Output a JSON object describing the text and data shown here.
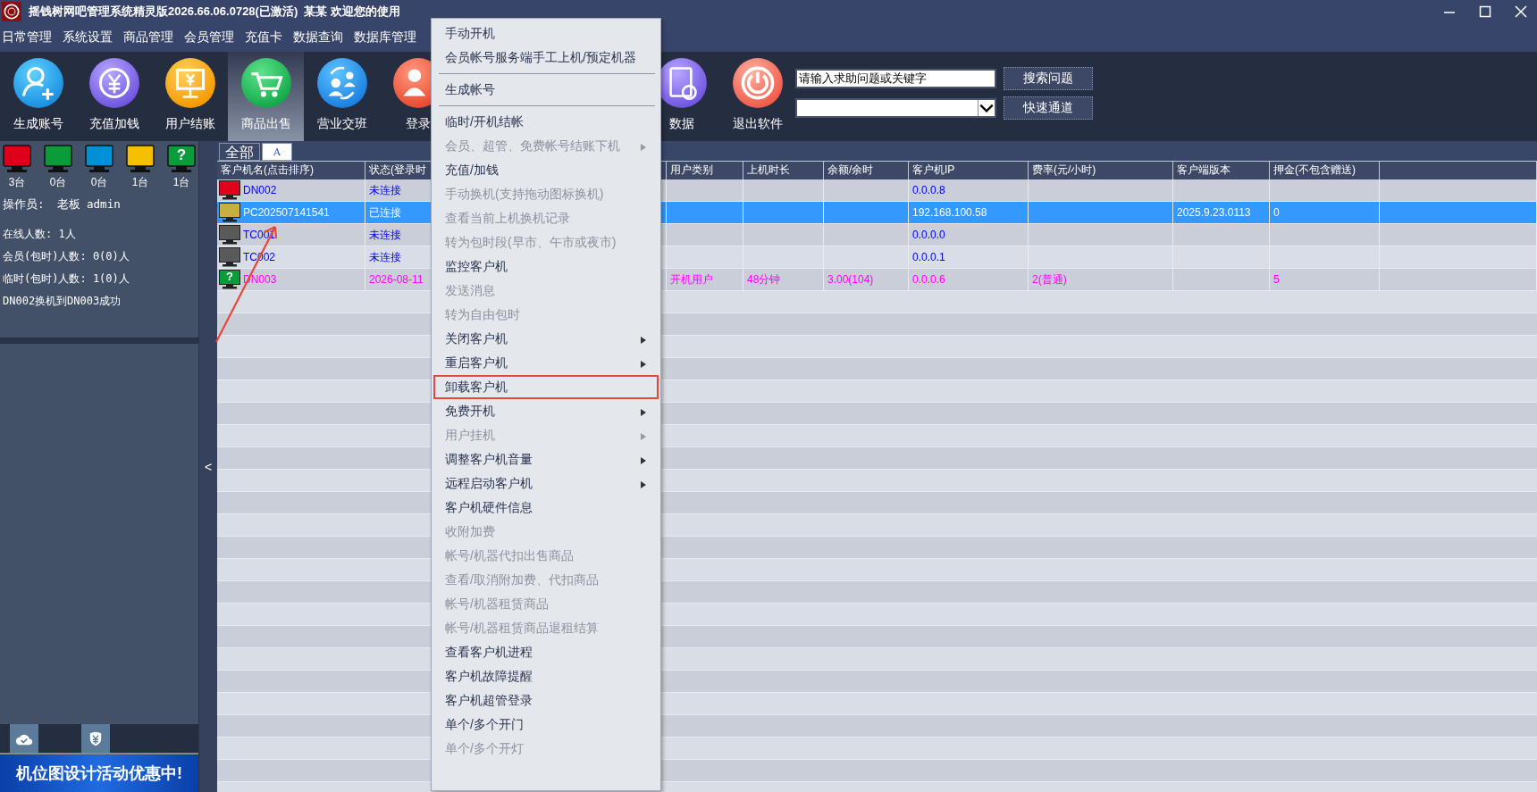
{
  "window": {
    "title": "摇钱树网吧管理系统精灵版2026.66.06.0728(已激活)  某某 欢迎您的使用"
  },
  "menu_bar": [
    "日常管理",
    "系统设置",
    "商品管理",
    "会员管理",
    "充值卡",
    "数据查询",
    "数据库管理"
  ],
  "toolbar": [
    {
      "label": "生成账号",
      "kind": "add-user",
      "selected": false
    },
    {
      "label": "充值加钱",
      "kind": "recharge",
      "selected": false
    },
    {
      "label": "用户结账",
      "kind": "checkout",
      "selected": false
    },
    {
      "label": "商品出售",
      "kind": "sale",
      "selected": true
    },
    {
      "label": "营业交班",
      "kind": "shift",
      "selected": false
    },
    {
      "label": "登录",
      "kind": "login",
      "selected": false
    },
    {
      "label": "数据",
      "kind": "data",
      "selected": false
    },
    {
      "label": "退出软件",
      "kind": "exit",
      "selected": false
    }
  ],
  "search": {
    "value": "请输入求助问题或关键字",
    "button": "搜索问题"
  },
  "quick_access": {
    "button": "快速通道"
  },
  "status_summary": [
    {
      "color": "#e0001b",
      "count": "3台"
    },
    {
      "color": "#0a9c3a",
      "count": "0台"
    },
    {
      "color": "#0090d8",
      "count": "0台"
    },
    {
      "color": "#f5c000",
      "count": "1台"
    },
    {
      "color": "#0a9c3a",
      "count": "1台",
      "badge": "?"
    }
  ],
  "operator": {
    "label": "操作员:",
    "name": "老板 admin"
  },
  "stats": [
    "在线人数: 1人",
    "会员(包时)人数: 0(0)人",
    "临时(包时)人数: 1(0)人"
  ],
  "message": "DN002换机到DN003成功",
  "collapse_button": "<",
  "banner": "机位图设计活动优惠中!",
  "tabs": [
    {
      "label": "全部",
      "selected": true
    },
    {
      "label": "A",
      "selected": false
    }
  ],
  "table": {
    "columns": [
      "客户机名(点击排序)",
      "状态(登录时",
      "用户类别",
      "上机时长",
      "余额/余时",
      "客户机IP",
      "费率(元/小时)",
      "客户端版本",
      "押金(不包含赠送)"
    ],
    "rows": [
      {
        "kind": "offline",
        "selected": false,
        "color": "#e0001b",
        "name": "DN002",
        "status": "未连接",
        "ip": "0.0.0.8"
      },
      {
        "kind": "online",
        "selected": true,
        "color": "#c8b040",
        "name": "PC202507141541",
        "status": "已连接",
        "ip": "192.168.100.58",
        "version": "2025.9.23.0113",
        "deposit": "0"
      },
      {
        "kind": "offline",
        "selected": false,
        "color": "#5a5a5a",
        "name": "TC001",
        "status": "未连接",
        "ip": "0.0.0.0"
      },
      {
        "kind": "offline",
        "selected": false,
        "color": "#5a5a5a",
        "name": "TC002",
        "status": "未连接",
        "ip": "0.0.0.1"
      },
      {
        "kind": "timed",
        "selected": false,
        "color": "#0a9c3a",
        "badge": "?",
        "name": "DN003",
        "status": "2026-08-11",
        "user_type": "开机用户",
        "online_time": "48分钟",
        "balance": "3.00(104)",
        "ip": "0.0.0.6",
        "rate": "2(普通)",
        "deposit": "5"
      }
    ]
  },
  "context_menu": [
    {
      "kind": "item",
      "label": "手动开机",
      "enabled": true,
      "submenu": false,
      "outlined": false
    },
    {
      "kind": "item",
      "label": "会员帐号服务端手工上机/预定机器",
      "enabled": true,
      "submenu": false,
      "outlined": false
    },
    {
      "kind": "separator"
    },
    {
      "kind": "item",
      "label": "生成帐号",
      "enabled": true,
      "submenu": false,
      "outlined": false
    },
    {
      "kind": "separator"
    },
    {
      "kind": "item",
      "label": "临时/开机结帐",
      "enabled": true,
      "submenu": false,
      "outlined": false
    },
    {
      "kind": "item",
      "label": "会员、超管、免费帐号结账下机",
      "enabled": false,
      "submenu": true,
      "outlined": false
    },
    {
      "kind": "item",
      "label": "充值/加钱",
      "enabled": true,
      "submenu": false,
      "outlined": false
    },
    {
      "kind": "item",
      "label": "手动换机(支持拖动图标换机)",
      "enabled": false,
      "submenu": false,
      "outlined": false
    },
    {
      "kind": "item",
      "label": "查看当前上机换机记录",
      "enabled": false,
      "submenu": false,
      "outlined": false
    },
    {
      "kind": "item",
      "label": "转为包时段(早市、午市或夜市)",
      "enabled": false,
      "submenu": false,
      "outlined": false
    },
    {
      "kind": "item",
      "label": "监控客户机",
      "enabled": true,
      "submenu": false,
      "outlined": false
    },
    {
      "kind": "item",
      "label": "发送消息",
      "enabled": false,
      "submenu": false,
      "outlined": false
    },
    {
      "kind": "item",
      "label": "转为自由包时",
      "enabled": false,
      "submenu": false,
      "outlined": false
    },
    {
      "kind": "item",
      "label": "关闭客户机",
      "enabled": true,
      "submenu": true,
      "outlined": false
    },
    {
      "kind": "item",
      "label": "重启客户机",
      "enabled": true,
      "submenu": true,
      "outlined": false
    },
    {
      "kind": "item",
      "label": "卸载客户机",
      "enabled": true,
      "submenu": false,
      "outlined": true
    },
    {
      "kind": "item",
      "label": "免费开机",
      "enabled": true,
      "submenu": true,
      "outlined": false
    },
    {
      "kind": "item",
      "label": "用户挂机",
      "enabled": false,
      "submenu": true,
      "outlined": false
    },
    {
      "kind": "item",
      "label": "调整客户机音量",
      "enabled": true,
      "submenu": true,
      "outlined": false
    },
    {
      "kind": "item",
      "label": "远程启动客户机",
      "enabled": true,
      "submenu": true,
      "outlined": false
    },
    {
      "kind": "item",
      "label": "客户机硬件信息",
      "enabled": true,
      "submenu": false,
      "outlined": false
    },
    {
      "kind": "item",
      "label": "收附加费",
      "enabled": false,
      "submenu": false,
      "outlined": false
    },
    {
      "kind": "item",
      "label": "帐号/机器代扣出售商品",
      "enabled": false,
      "submenu": false,
      "outlined": false
    },
    {
      "kind": "item",
      "label": "查看/取消附加费、代扣商品",
      "enabled": false,
      "submenu": false,
      "outlined": false
    },
    {
      "kind": "item",
      "label": "帐号/机器租赁商品",
      "enabled": false,
      "submenu": false,
      "outlined": false
    },
    {
      "kind": "item",
      "label": "帐号/机器租赁商品退租结算",
      "enabled": false,
      "submenu": false,
      "outlined": false
    },
    {
      "kind": "item",
      "label": "查看客户机进程",
      "enabled": true,
      "submenu": false,
      "outlined": false
    },
    {
      "kind": "item",
      "label": "客户机故障提醒",
      "enabled": true,
      "submenu": false,
      "outlined": false
    },
    {
      "kind": "item",
      "label": "客户机超管登录",
      "enabled": true,
      "submenu": false,
      "outlined": false
    },
    {
      "kind": "item",
      "label": "单个/多个开门",
      "enabled": true,
      "submenu": false,
      "outlined": false
    },
    {
      "kind": "item",
      "label": "单个/多个开灯",
      "enabled": false,
      "submenu": false,
      "outlined": false
    }
  ]
}
